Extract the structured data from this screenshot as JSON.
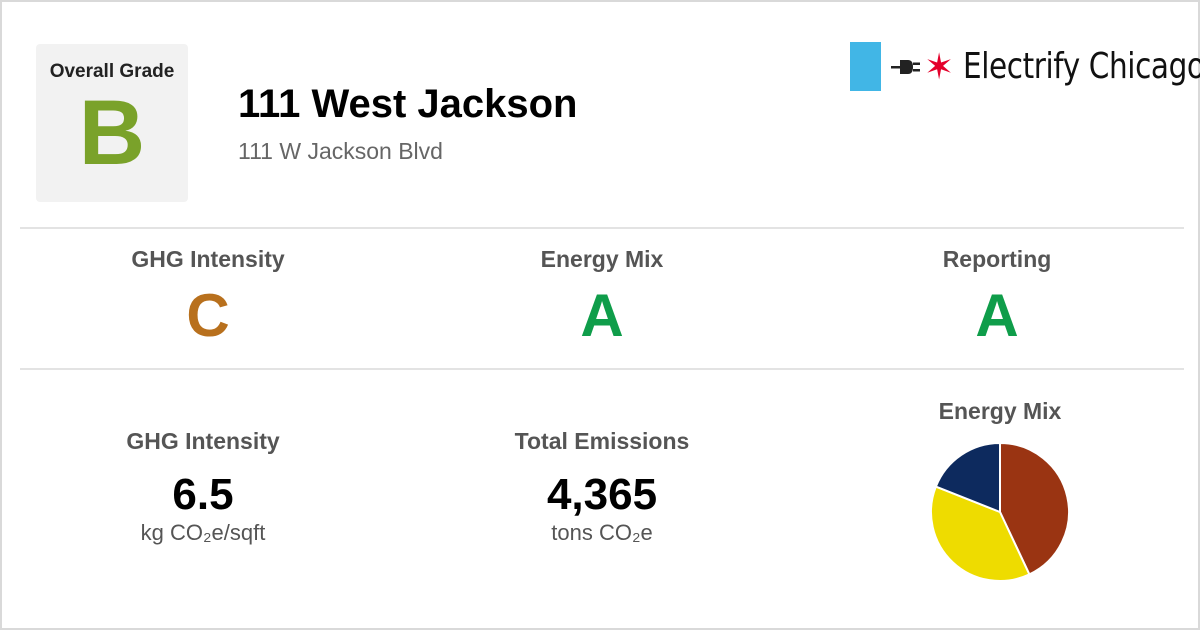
{
  "header": {
    "overall_label": "Overall Grade",
    "overall_grade": "B",
    "overall_color": "#7aa22a",
    "building_name": "111 West Jackson",
    "address": "111 W Jackson Blvd"
  },
  "logo": {
    "text": "Electrify Chicago",
    "icons": [
      "chicago-flag-stripe",
      "plug-icon",
      "red-star-icon"
    ],
    "colors": {
      "flag": "#41b6e6",
      "star": "#e4002b"
    }
  },
  "grades": [
    {
      "label": "GHG Intensity",
      "grade": "C",
      "color": "#b8701d"
    },
    {
      "label": "Energy Mix",
      "grade": "A",
      "color": "#0f9d4a"
    },
    {
      "label": "Reporting",
      "grade": "A",
      "color": "#0f9d4a"
    }
  ],
  "metrics": {
    "ghg_intensity": {
      "label": "GHG Intensity",
      "value": "6.5",
      "unit": "kg CO₂e/sqft"
    },
    "total_emissions": {
      "label": "Total Emissions",
      "value": "4,365",
      "unit": "tons CO₂e"
    }
  },
  "energy_mix": {
    "title": "Energy Mix"
  },
  "chart_data": {
    "type": "pie",
    "title": "Energy Mix",
    "slices": [
      {
        "value": 43,
        "color": "#9a3412"
      },
      {
        "value": 38,
        "color": "#eedc00"
      },
      {
        "value": 19,
        "color": "#0d2a5e"
      }
    ]
  }
}
